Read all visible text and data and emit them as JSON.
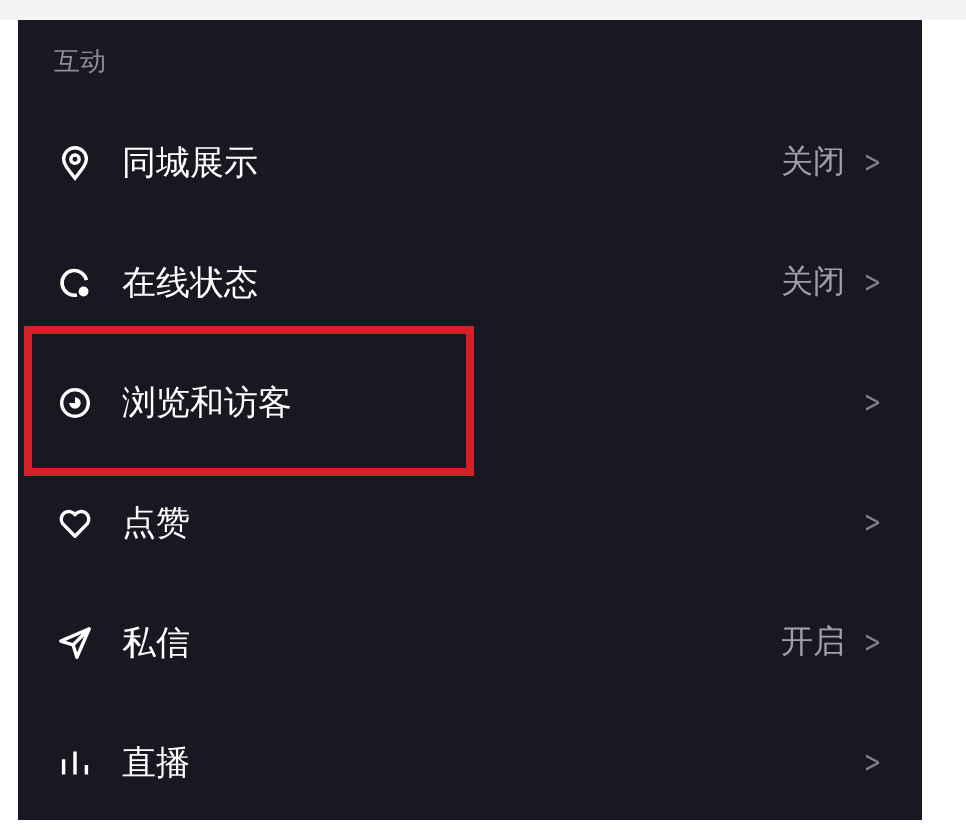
{
  "section": {
    "title": "互动"
  },
  "items": [
    {
      "kind": "pin",
      "label": "同城展示",
      "value": "关闭",
      "highlighted": false
    },
    {
      "kind": "status",
      "label": "在线状态",
      "value": "关闭",
      "highlighted": false
    },
    {
      "kind": "eye",
      "label": "浏览和访客",
      "highlighted": true
    },
    {
      "kind": "heart",
      "label": "点赞",
      "highlighted": false
    },
    {
      "kind": "send",
      "label": "私信",
      "value": "开启",
      "highlighted": false
    },
    {
      "kind": "bars",
      "label": "直播",
      "highlighted": false
    }
  ],
  "chevron": ">"
}
